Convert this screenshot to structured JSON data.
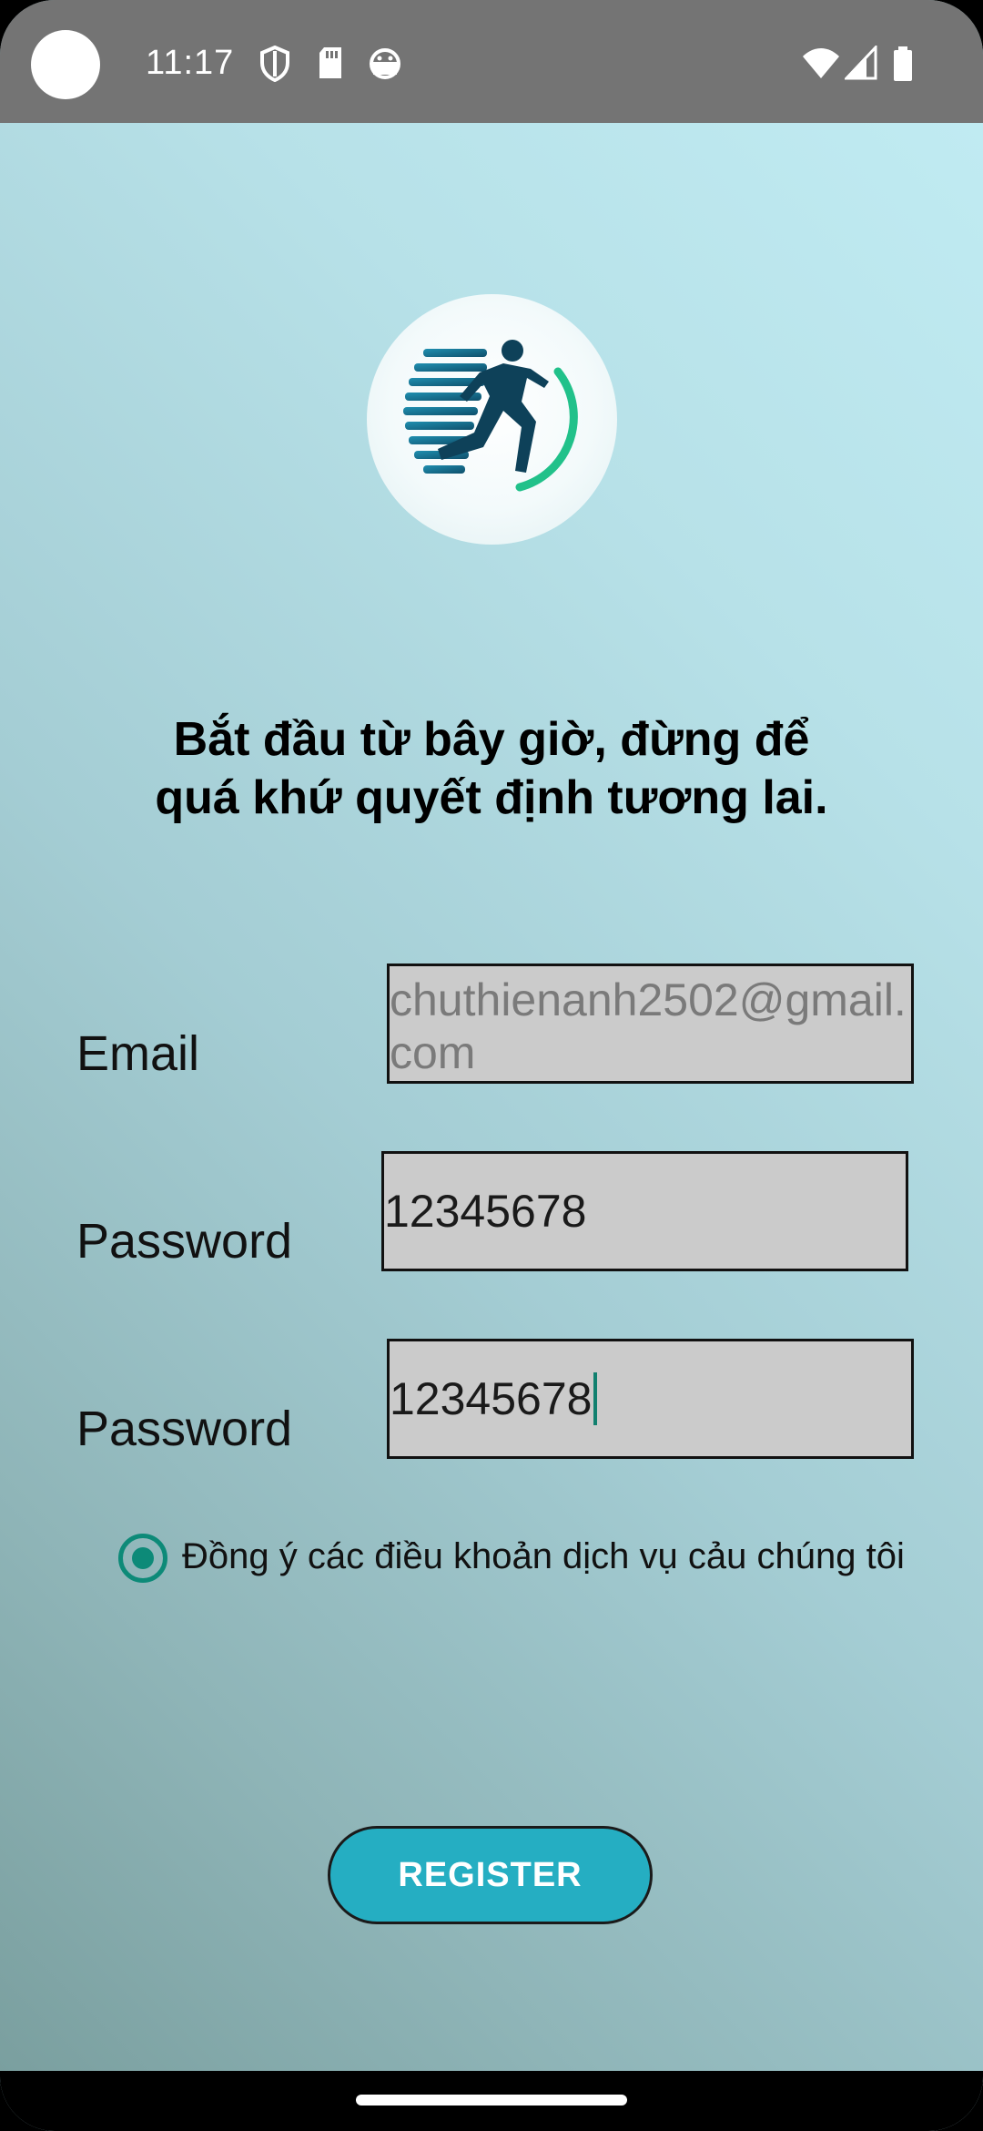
{
  "status_bar": {
    "time": "11:17",
    "icons": [
      "shield-icon",
      "sd-card-icon",
      "android-icon",
      "wifi-icon",
      "signal-icon",
      "battery-icon"
    ]
  },
  "logo": {
    "icon": "runner-logo-icon"
  },
  "headline": {
    "line1": "Bắt đầu từ bây giờ, đừng để",
    "line2": "quá khứ quyết định tương lai."
  },
  "form": {
    "email": {
      "label": "Email",
      "value": "chuthienanh2502@gmail.com"
    },
    "password": {
      "label": "Password",
      "value": "12345678"
    },
    "confirm_password": {
      "label": "Password",
      "value": "12345678"
    }
  },
  "terms": {
    "label": "Đồng ý các điều khoản dịch vụ cảu chúng tôi",
    "checked": true
  },
  "register_button": {
    "label": "REGISTER"
  },
  "colors": {
    "accent": "#25aec2",
    "radio": "#0d8a78",
    "field_bg": "#cbcbcb",
    "status_bar": "#747474"
  }
}
